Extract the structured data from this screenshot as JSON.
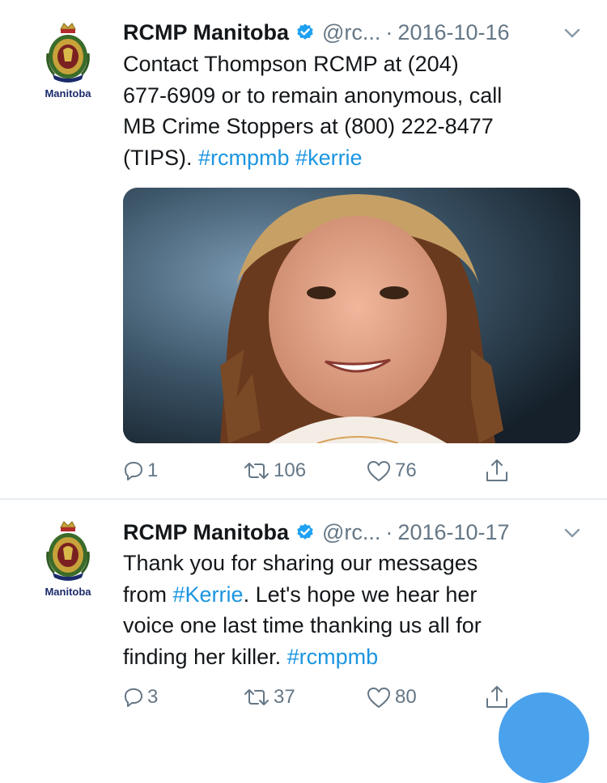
{
  "tweets": [
    {
      "author": {
        "name": "RCMP Manitoba",
        "handle": "@rc...",
        "avatar_label": "Manitoba",
        "verified": true
      },
      "separator": "·",
      "date": "2016-10-16",
      "text_lines": [
        [
          {
            "text": "Contact Thompson RCMP at (204)",
            "type": "text"
          }
        ],
        [
          {
            "text": "677-6909 or to remain anonymous, call",
            "type": "text"
          }
        ],
        [
          {
            "text": "MB Crime Stoppers at (800) 222-8477",
            "type": "text"
          }
        ],
        [
          {
            "text": "(TIPS). ",
            "type": "text"
          },
          {
            "text": "#rcmpmb",
            "type": "hashtag"
          },
          {
            "text": " ",
            "type": "text"
          },
          {
            "text": "#kerrie",
            "type": "hashtag"
          }
        ]
      ],
      "has_media": true,
      "actions": {
        "replies": "1",
        "retweets": "106",
        "likes": "76"
      }
    },
    {
      "author": {
        "name": "RCMP Manitoba",
        "handle": "@rc...",
        "avatar_label": "Manitoba",
        "verified": true
      },
      "separator": "·",
      "date": "2016-10-17",
      "text_lines": [
        [
          {
            "text": "Thank you for sharing our messages",
            "type": "text"
          }
        ],
        [
          {
            "text": "from ",
            "type": "text"
          },
          {
            "text": "#Kerrie",
            "type": "hashtag"
          },
          {
            "text": ". Let's hope we hear her",
            "type": "text"
          }
        ],
        [
          {
            "text": "voice one last time thanking us all for",
            "type": "text"
          }
        ],
        [
          {
            "text": "finding her killer. ",
            "type": "text"
          },
          {
            "text": "#rcmpmb",
            "type": "hashtag"
          }
        ]
      ],
      "has_media": false,
      "actions": {
        "replies": "3",
        "retweets": "37",
        "likes": "80"
      }
    }
  ],
  "icons": {
    "verified": "verified-badge-icon",
    "menu": "chevron-down-icon",
    "reply": "reply-icon",
    "retweet": "retweet-icon",
    "like": "heart-icon",
    "share": "share-icon",
    "avatar": "rcmp-crest-icon",
    "compose": "compose-fab"
  },
  "colors": {
    "text": "#14171a",
    "secondary": "#657786",
    "link": "#1b95e0",
    "verified": "#1da1f2",
    "separator": "#e6ecf0",
    "fab": "#4aa1ec"
  }
}
